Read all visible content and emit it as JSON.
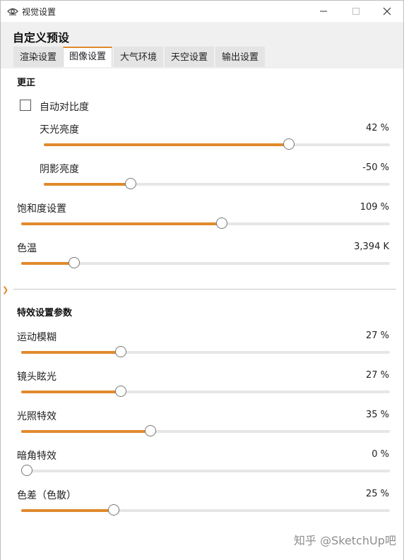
{
  "window": {
    "title": "视觉设置"
  },
  "header": {
    "preset_title": "自定义预设"
  },
  "tabs": [
    {
      "label": "渲染设置",
      "active": false
    },
    {
      "label": "图像设置",
      "active": true
    },
    {
      "label": "大气环境",
      "active": false
    },
    {
      "label": "天空设置",
      "active": false
    },
    {
      "label": "输出设置",
      "active": false
    }
  ],
  "correction": {
    "title": "更正",
    "auto_contrast_label": "自动对比度",
    "auto_contrast_checked": false,
    "sliders": [
      {
        "label": "天光亮度",
        "value": "42 %",
        "fraction": 0.708
      },
      {
        "label": "阴影亮度",
        "value": "-50 %",
        "fraction": 0.25
      },
      {
        "label": "饱和度设置",
        "value": "109 %",
        "fraction": 0.545
      },
      {
        "label": "色温",
        "value": "3,394 K",
        "fraction": 0.143
      }
    ]
  },
  "effects": {
    "title": "特效设置参数",
    "sliders": [
      {
        "label": "运动模糊",
        "value": "27 %",
        "fraction": 0.27
      },
      {
        "label": "镜头眩光",
        "value": "27 %",
        "fraction": 0.27
      },
      {
        "label": "光照特效",
        "value": "35 %",
        "fraction": 0.35
      },
      {
        "label": "暗角特效",
        "value": "0 %",
        "fraction": 0.0
      },
      {
        "label": "色差（色散）",
        "value": "25 %",
        "fraction": 0.25
      }
    ]
  },
  "watermark": "知乎 @SketchUp吧",
  "colors": {
    "accent": "#e08a2c",
    "track": "#e6e6e6",
    "header_bg": "#f0f0f0"
  }
}
